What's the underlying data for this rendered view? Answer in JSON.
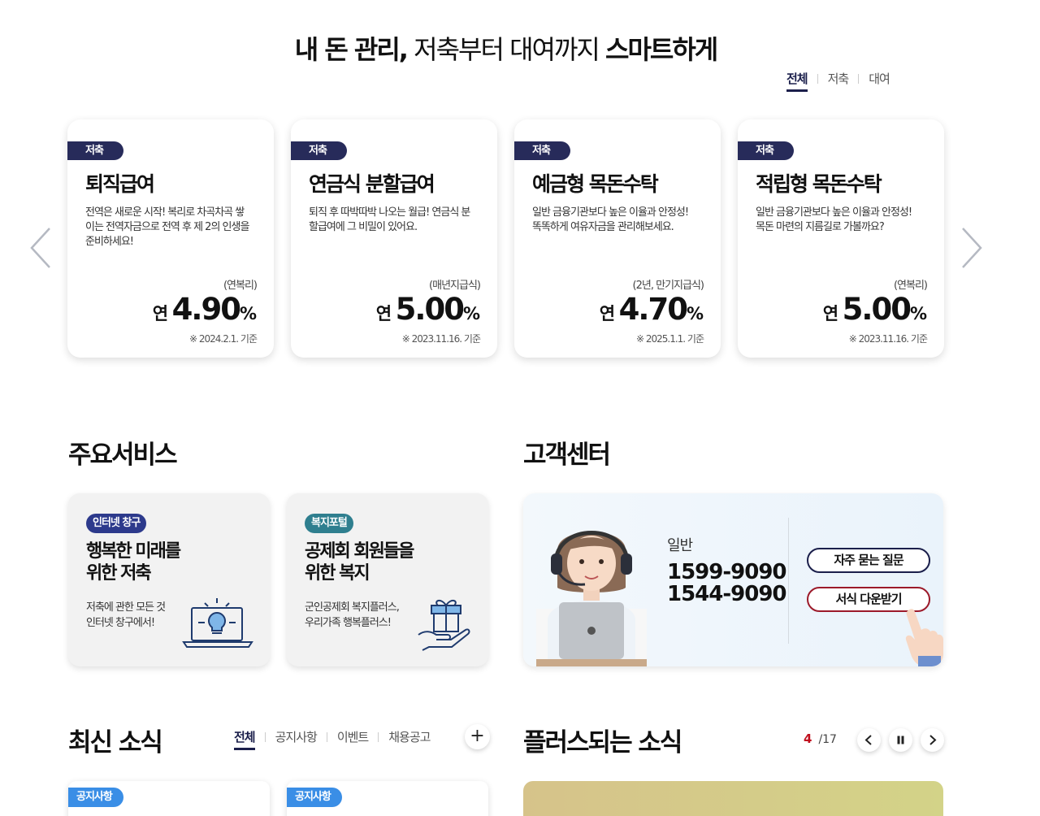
{
  "hero": {
    "title_bold1": "내 돈 관리,",
    "title_thin": "저축부터 대여까지",
    "title_bold2": "스마트하게"
  },
  "filter_tabs": [
    "전체",
    "저축",
    "대여"
  ],
  "products": [
    {
      "badge": "저축",
      "title": "퇴직급여",
      "desc": "전역은 새로운 시작! 복리로 차곡차곡 쌓이는 전역자금으로 전역 후 제 2의 인생을 준비하세요!",
      "note": "(연복리)",
      "rate_prefix": "연",
      "rate": "4.90",
      "rate_unit": "%",
      "basis": "※ 2024.2.1. 기준"
    },
    {
      "badge": "저축",
      "title": "연금식 분할급여",
      "desc": "퇴직 후 따박따박 나오는 월급! 연금식 분할급여에 그 비밀이 있어요.",
      "note": "(매년지급식)",
      "rate_prefix": "연",
      "rate": "5.00",
      "rate_unit": "%",
      "basis": "※ 2023.11.16. 기준"
    },
    {
      "badge": "저축",
      "title": "예금형 목돈수탁",
      "desc": "일반 금융기관보다 높은 이율과 안정성! 똑똑하게 여유자금을 관리해보세요.",
      "note": "(2년, 만기지급식)",
      "rate_prefix": "연",
      "rate": "4.70",
      "rate_unit": "%",
      "basis": "※ 2025.1.1. 기준"
    },
    {
      "badge": "저축",
      "title": "적립형 목돈수탁",
      "desc": "일반 금융기관보다 높은 이율과 안정성! 목돈 마련의 지름길로 가볼까요?",
      "note": "(연복리)",
      "rate_prefix": "연",
      "rate": "5.00",
      "rate_unit": "%",
      "basis": "※ 2023.11.16. 기준"
    }
  ],
  "services": {
    "title": "주요서비스",
    "items": [
      {
        "badge": "인터넷 창구",
        "badge_color": "#2d3a8c",
        "title_line1": "행복한 미래를",
        "title_line2": "위한 저축",
        "desc_line1": "저축에 관한 모든 것",
        "desc_line2": "인터넷 창구에서!",
        "icon": "laptop-bulb-icon"
      },
      {
        "badge": "복지포털",
        "badge_color": "#2f7f8f",
        "title_line1": "공제회 회원들을",
        "title_line2": "위한 복지",
        "desc_line1": "군인공제회 복지플러스,",
        "desc_line2": "우리가족 행복플러스!",
        "icon": "gift-hand-icon"
      }
    ]
  },
  "customer_center": {
    "title": "고객센터",
    "label": "일반",
    "phone1": "1599-9090",
    "phone2": "1544-9090",
    "faq_button": "자주 묻는 질문",
    "form_button": "서식 다운받기"
  },
  "news": {
    "title": "최신 소식",
    "tabs": [
      "전체",
      "공지사항",
      "이벤트",
      "채용공고"
    ],
    "more": "+",
    "cards": [
      {
        "badge": "공지사항"
      },
      {
        "badge": "공지사항"
      }
    ]
  },
  "plus_news": {
    "title": "플러스되는 소식",
    "current": "4",
    "total": "/17"
  },
  "colors": {
    "navy": "#1b1f4b",
    "badge_navy": "#272b5a",
    "accent_red": "#c0101e",
    "news_badge": "#3a8ee6"
  }
}
